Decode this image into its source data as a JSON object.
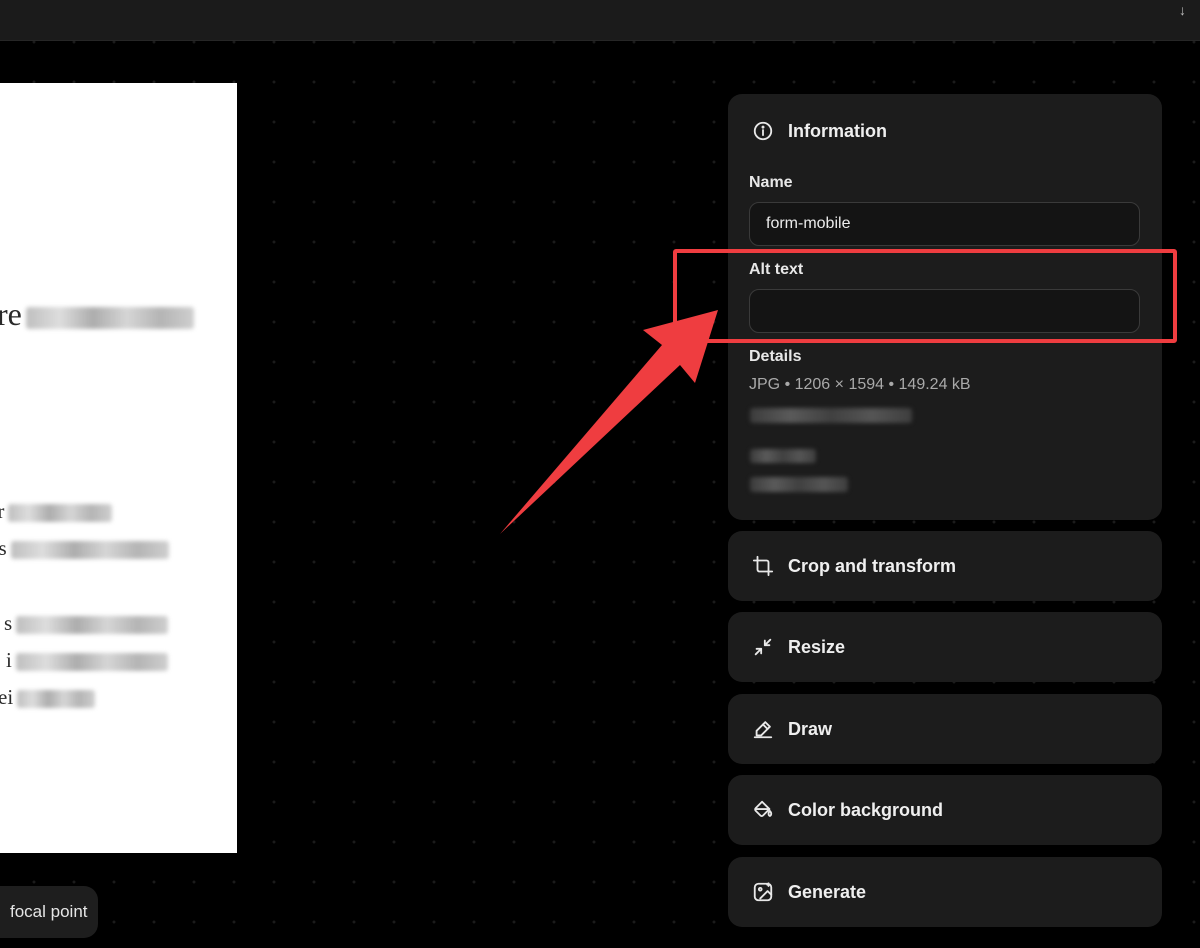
{
  "canvas": {
    "heading_visible": "re",
    "body_fragments": [
      "er",
      "ns",
      "s",
      "i",
      "ei"
    ],
    "focal_button_label": "focal point"
  },
  "panel": {
    "title": "Information",
    "title_icon": "info-circle-icon",
    "name_label": "Name",
    "name_value": "form-mobile",
    "alt_label": "Alt text",
    "alt_value": "",
    "details_label": "Details",
    "details_meta": "JPG • 1206 × 1594 • 149.24 kB"
  },
  "tools": [
    {
      "label": "Crop and transform",
      "icon": "crop-icon"
    },
    {
      "label": "Resize",
      "icon": "resize-icon"
    },
    {
      "label": "Draw",
      "icon": "draw-icon"
    },
    {
      "label": "Color background",
      "icon": "paint-bucket-icon"
    },
    {
      "label": "Generate",
      "icon": "generate-icon"
    }
  ],
  "colors": {
    "annotation": "#ef3d40",
    "panel_bg": "#1c1c1c",
    "page_bg": "#000000"
  }
}
